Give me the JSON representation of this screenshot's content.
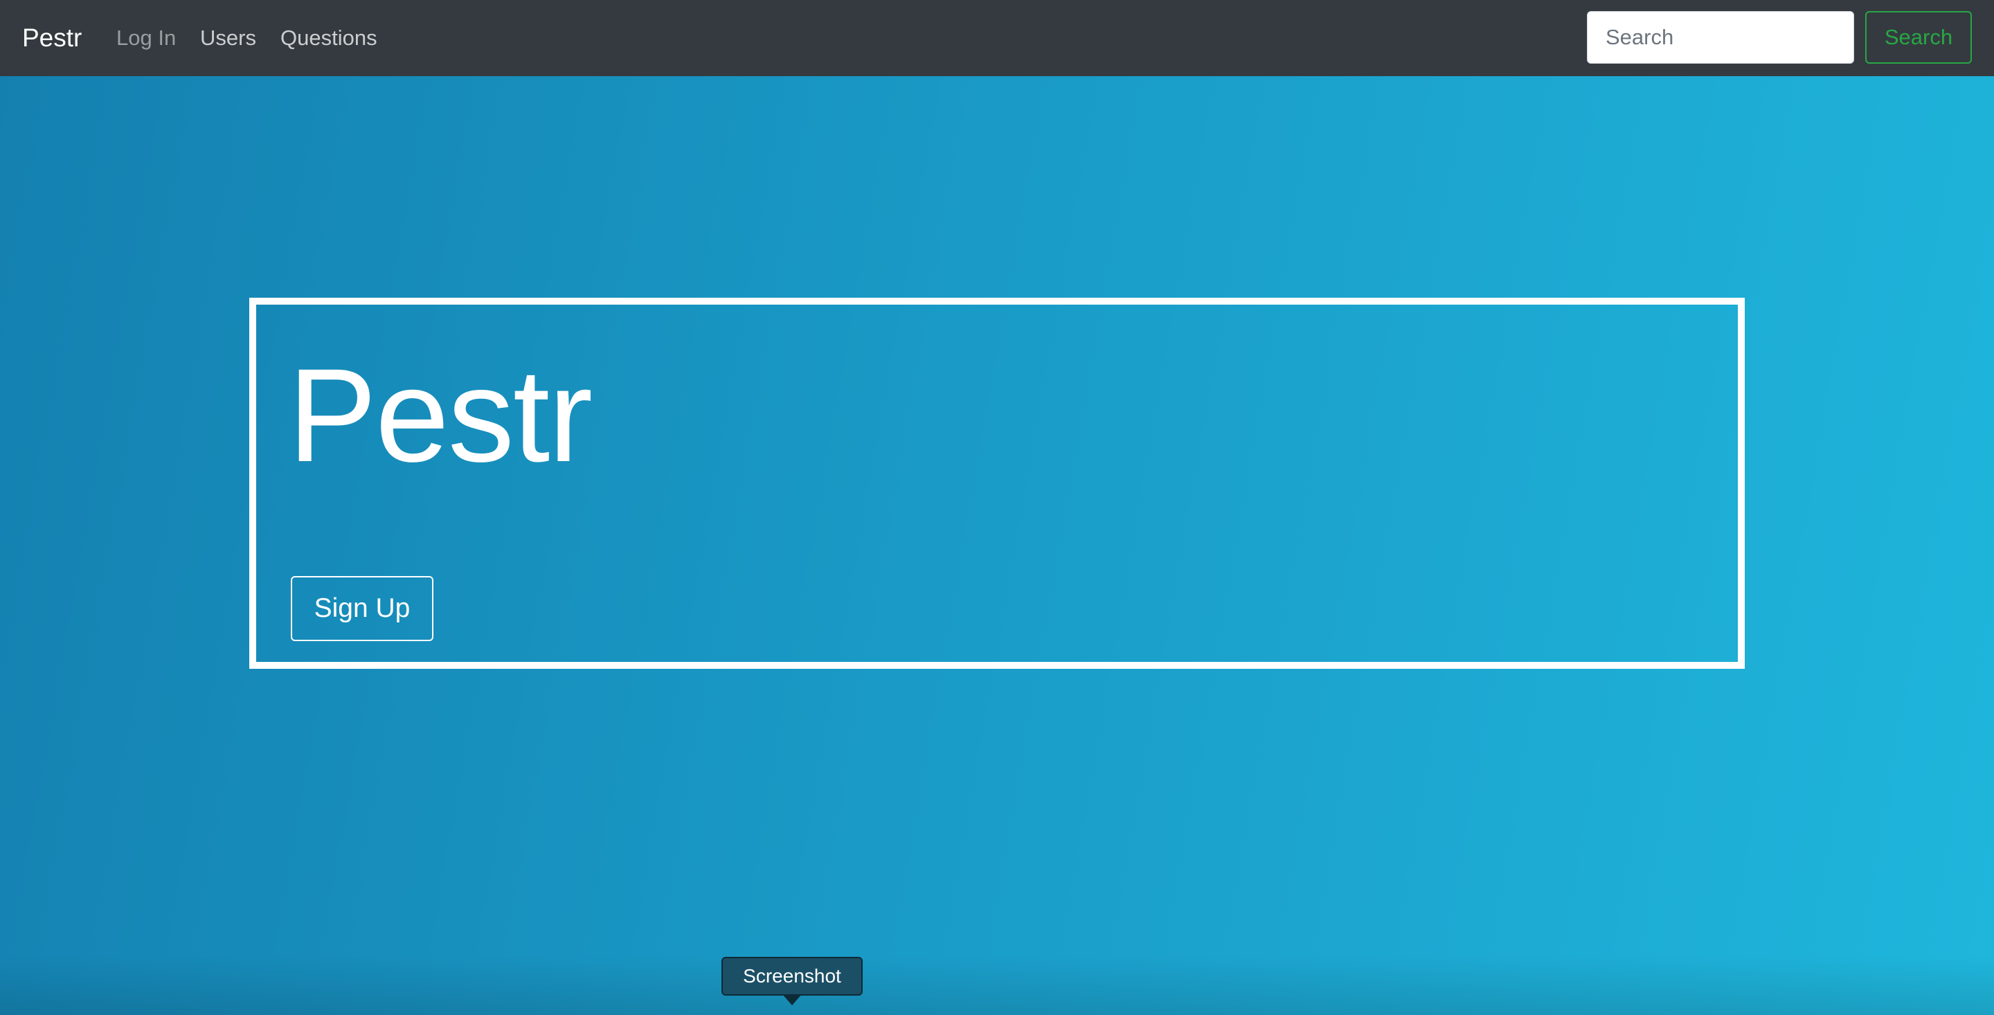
{
  "navbar": {
    "brand": "Pestr",
    "links": [
      {
        "label": "Log In",
        "state": "muted"
      },
      {
        "label": "Users",
        "state": "active"
      },
      {
        "label": "Questions",
        "state": "active"
      }
    ],
    "search": {
      "placeholder": "Search",
      "value": "",
      "button_label": "Search"
    }
  },
  "hero": {
    "title": "Pestr",
    "signup_label": "Sign Up"
  },
  "tooltip": {
    "label": "Screenshot"
  },
  "colors": {
    "navbar_bg": "#343a40",
    "success": "#28a745",
    "hero_gradient_start": "#1480b0",
    "hero_gradient_end": "#1fb6dc"
  },
  "icons": []
}
